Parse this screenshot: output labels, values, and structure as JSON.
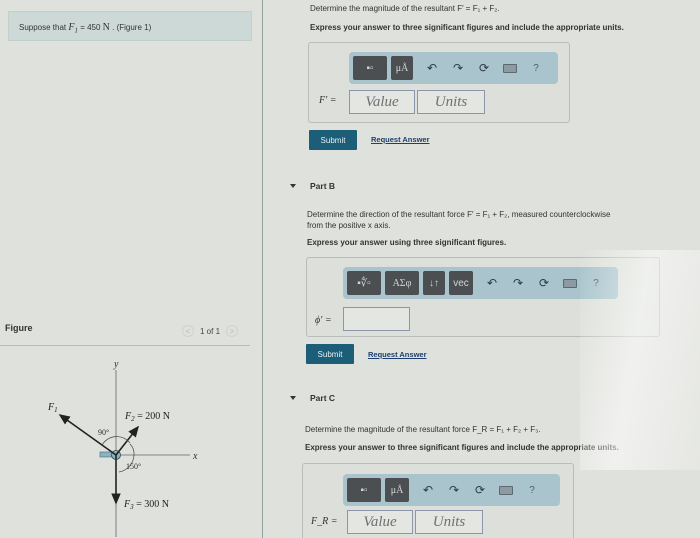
{
  "problem": {
    "intro_prefix": "Suppose that ",
    "var": "F",
    "var_sub": "1",
    "equals": " = 450 ",
    "unit": "N",
    "suffix": " . (Figure 1)"
  },
  "figure": {
    "header": "Figure",
    "pager_prev": "<",
    "pager_text": "1 of 1",
    "pager_next": ">",
    "labels": {
      "y_axis": "y",
      "x_axis": "x",
      "f1": "F",
      "f1_sub": "1",
      "f2": "F",
      "f2_sub": "2",
      "f2_value": " = 200 N",
      "f3": "F",
      "f3_sub": "3",
      "f3_value": " = 300 N",
      "angle_90": "90°",
      "angle_150": "150°"
    }
  },
  "part_a": {
    "question": "Determine the magnitude of the resultant F′ = F₁ + F₂.",
    "instruction": "Express your answer to three significant figures and include the appropriate units.",
    "toolbar": {
      "template_btn": "▪▫",
      "units_btn": "μÅ",
      "undo": "↶",
      "redo": "↷",
      "reset": "⟳",
      "help": "?"
    },
    "answer_label": "F′ =",
    "value_placeholder": "Value",
    "units_placeholder": "Units",
    "submit": "Submit",
    "request_answer": "Request Answer"
  },
  "part_b": {
    "title": "Part B",
    "question_line1": "Determine the direction of the resultant force F′ = F₁ + F₂, measured counterclockwise",
    "question_line2": "from the positive x axis.",
    "instruction": "Express your answer using three significant figures.",
    "toolbar": {
      "template_btn": "▪∜▫",
      "greek_btn": "ΑΣφ",
      "arrows_btn": "↓↑",
      "vec_btn": "vec",
      "undo": "↶",
      "redo": "↷",
      "reset": "⟳",
      "help": "?"
    },
    "answer_label": "ϕ′ =",
    "answer_value": "",
    "submit": "Submit",
    "request_answer": "Request Answer"
  },
  "part_c": {
    "title": "Part C",
    "question": "Determine the magnitude of the resultant force F_R = F₁ + F₂ + F₃.",
    "instruction": "Express your answer to three significant figures and include the appropriate units.",
    "toolbar": {
      "template_btn": "▪▫",
      "units_btn": "μÅ",
      "undo": "↶",
      "redo": "↷",
      "reset": "⟳",
      "help": "?"
    },
    "answer_label": "F_R =",
    "value_placeholder": "Value",
    "units_placeholder": "Units"
  },
  "colors": {
    "submit_bg": "#1c5e77",
    "toolbar_bg": "#a9c4cc",
    "banner_bg": "#cdd9d6",
    "link": "#1d3f6e"
  }
}
